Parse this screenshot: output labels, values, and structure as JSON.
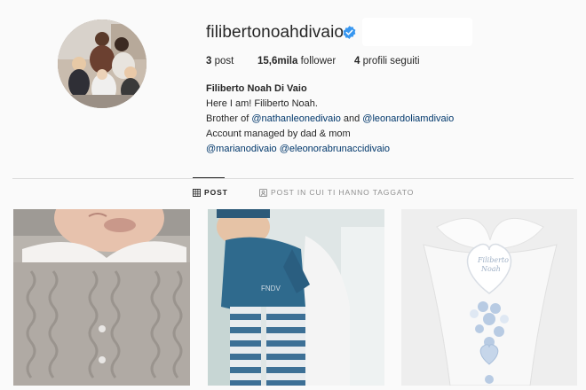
{
  "profile": {
    "username": "filibertonoahdivaio",
    "verified_icon": "verified-badge-icon",
    "stats": {
      "posts_value": "3",
      "posts_label": "post",
      "followers_value": "15,6mila",
      "followers_label": "follower",
      "following_value": "4",
      "following_label": "profili seguiti"
    },
    "bio": {
      "name": "Filiberto Noah Di Vaio",
      "line1": "Here I am! Filiberto Noah.",
      "line2_prefix": "Brother of ",
      "mention1": "@nathanleonedivaio",
      "line2_mid": " and ",
      "mention2": "@leonardoliamdivaio",
      "line3": "Account managed by dad & mom",
      "mention3": "@marianodivaio",
      "mention4": "@eleonorabrunaccidivaio"
    }
  },
  "tabs": {
    "posts_label": "POST",
    "tagged_label": "POST IN CUI TI HANNO TAGGATO"
  },
  "colors": {
    "accent_verified": "#3897f0",
    "link": "#00376b",
    "background": "#fafafa"
  },
  "posts": [
    {
      "name": "post-1"
    },
    {
      "name": "post-2",
      "caption_text": "FNDV"
    },
    {
      "name": "post-3",
      "decor_text": "Filiberto Noah"
    }
  ]
}
